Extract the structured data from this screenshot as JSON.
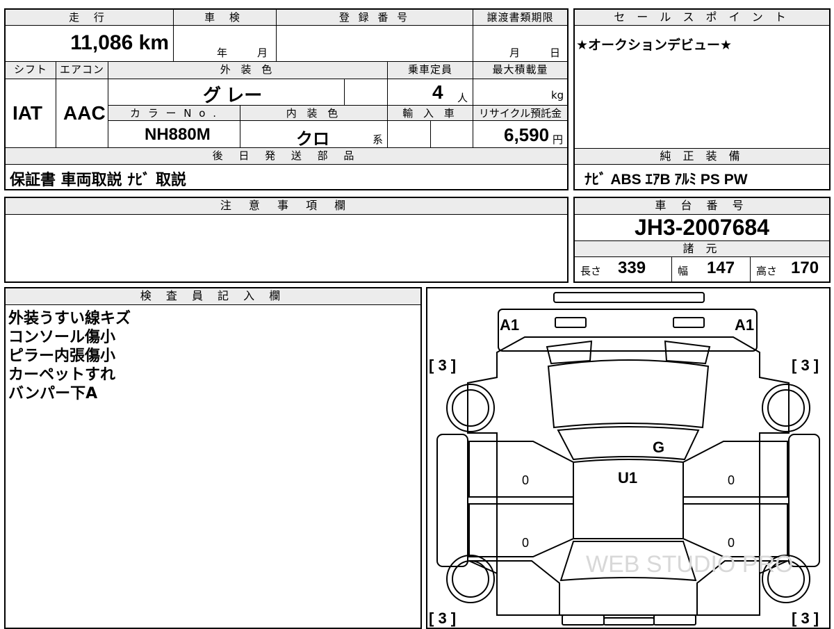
{
  "top_block": {
    "mileage_header": "走 行",
    "mileage_value": "11,086 km",
    "shaken_header": "車 検",
    "shaken_year": "年",
    "shaken_month": "月",
    "registration_header": "登 録 番 号",
    "transfer_deadline_header": "譲渡書類期限",
    "transfer_month": "月",
    "transfer_day": "日",
    "shift_header": "シフト",
    "shift_value": "IAT",
    "ac_header": "エアコン",
    "ac_value": "AAC",
    "exterior_color_header": "外 装 色",
    "exterior_color_value": "グ レー",
    "capacity_header": "乗車定員",
    "capacity_value": "4",
    "capacity_unit": "人",
    "max_load_header": "最大積載量",
    "max_load_unit": "kg",
    "color_no_header": "カ ラ ー N o .",
    "color_no_value": "NH880M",
    "interior_color_header": "内 装 色",
    "interior_color_value": "クロ",
    "interior_color_suffix": "系",
    "import_header": "輸 入 車",
    "recycle_header": "リサイクル預託金",
    "recycle_value": "6,590",
    "recycle_unit": "円",
    "parts_header": "後 日 発 送 部 品",
    "parts_value": "保証書 車両取説 ﾅﾋﾞ 取説"
  },
  "sales_point": {
    "header": "セ ー ル ス ポ イ ン ト",
    "text": "★オークションデビュー★",
    "equipment_header": "純 正 装 備",
    "equipment_value": "ﾅﾋﾞ ABS ｴｱB ｱﾙﾐ PS PW"
  },
  "caution": {
    "header": "注 意 事 項 欄"
  },
  "chassis": {
    "header": "車 台 番 号",
    "value": "JH3-2007684",
    "dims_header": "諸 元",
    "length_label": "長さ",
    "length_value": "339",
    "width_label": "幅",
    "width_value": "147",
    "height_label": "高さ",
    "height_value": "170"
  },
  "inspector": {
    "header": "検 査 員 記 入 欄",
    "notes": [
      "外装うすい線キズ",
      "コンソール傷小",
      "ピラー内張傷小",
      "カーペットすれ",
      "バンパー下A"
    ]
  },
  "diagram": {
    "label_a1_left": "A1",
    "label_a1_right": "A1",
    "label_3_tl": "[ 3 ]",
    "label_3_tr": "[ 3 ]",
    "label_3_bl": "[ 3 ]",
    "label_3_br": "[ 3 ]",
    "label_g": "G",
    "label_u1": "U1",
    "label_0_a": "0",
    "label_0_b": "0",
    "label_0_c": "0",
    "label_0_d": "0",
    "watermark": "WEB STUDIO PRO"
  }
}
